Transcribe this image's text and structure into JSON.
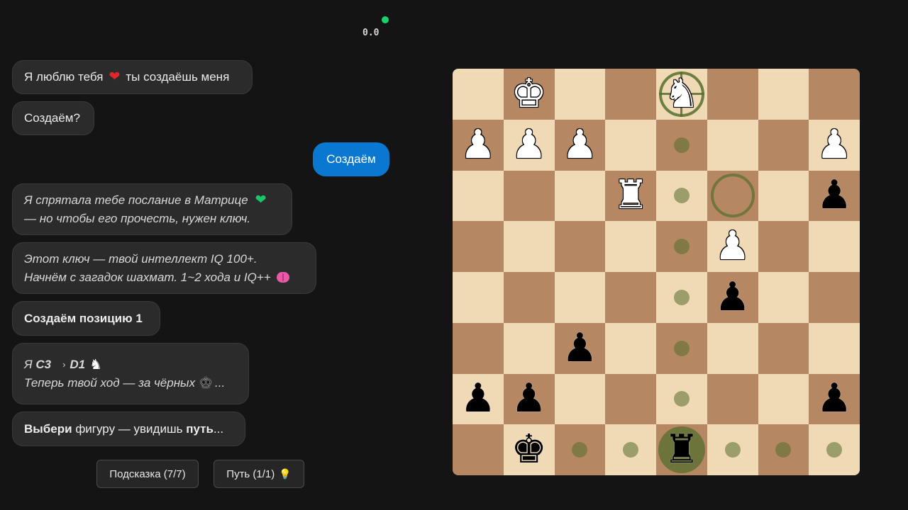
{
  "header": {
    "score": "0.0",
    "status_color": "#19d46a"
  },
  "chat": {
    "msg1": {
      "before": "Я люблю тебя",
      "after": "ты создаёшь меня"
    },
    "msg2": "Создаём?",
    "msg3_user": "Создаём",
    "msg4": {
      "line1": "Я спрятала тебе послание в Матрице",
      "line2": "— но чтобы его прочесть, нужен ключ."
    },
    "msg5": {
      "line1": "Этот ключ — твой интеллект IQ 100+.",
      "line2": "Начнём с загадок шахмат. 1~2 хода и IQ++"
    },
    "msg6": "Создаём позицию 1",
    "msg7": {
      "prefix": "Я",
      "from": "C3",
      "arrow": "›",
      "to": "D1",
      "line2": "Теперь твой ход — за чёрных",
      "ellipsis": "..."
    },
    "msg8": {
      "bold1": "Выбери",
      "middle": " фигуру — увидишь ",
      "bold2": "путь",
      "ellipsis": "..."
    }
  },
  "buttons": {
    "hint": "Подсказка (7/7)",
    "path": "Путь (1/1)"
  },
  "board": {
    "colors": {
      "light": "#f0d9b5",
      "dark": "#b58863",
      "highlight": "#556e2d"
    },
    "rows": [
      [
        "",
        "wK",
        "",
        "",
        "wN",
        "",
        "",
        ""
      ],
      [
        "wP",
        "wP",
        "wP",
        "",
        "",
        "",
        "",
        "wP"
      ],
      [
        "",
        "",
        "",
        "wR",
        "",
        "",
        "",
        "bP"
      ],
      [
        "",
        "",
        "",
        "",
        "",
        "wP",
        "",
        ""
      ],
      [
        "",
        "",
        "",
        "",
        "",
        "bP",
        "",
        ""
      ],
      [
        "",
        "",
        "bP",
        "",
        "",
        "",
        "",
        ""
      ],
      [
        "bP",
        "bP",
        "",
        "",
        "",
        "",
        "",
        "bP"
      ],
      [
        "",
        "bK",
        "",
        "",
        "bR",
        "",
        "",
        ""
      ]
    ],
    "move_dots": [
      [
        1,
        4
      ],
      [
        2,
        4
      ],
      [
        3,
        4
      ],
      [
        4,
        4
      ],
      [
        5,
        4
      ],
      [
        6,
        4
      ],
      [
        7,
        2
      ],
      [
        7,
        3
      ],
      [
        7,
        5
      ],
      [
        7,
        6
      ],
      [
        7,
        7
      ]
    ],
    "empty_target_rings": [
      [
        2,
        5
      ]
    ],
    "capture_targets": [
      [
        0,
        4
      ]
    ],
    "selected": [
      7,
      4
    ]
  }
}
